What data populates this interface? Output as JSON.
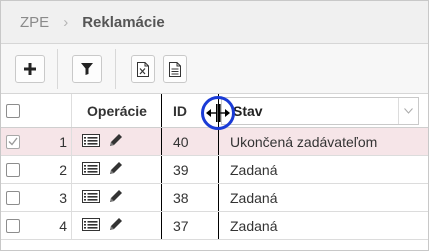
{
  "breadcrumb": {
    "root": "ZPE",
    "separator": "›",
    "current": "Reklamácie"
  },
  "toolbar": {
    "buttons": [
      {
        "name": "add-button",
        "icon": "plus-icon"
      },
      {
        "name": "filter-button",
        "icon": "funnel-icon"
      },
      {
        "name": "export-excel-button",
        "icon": "excel-file-icon"
      },
      {
        "name": "export-document-button",
        "icon": "document-icon"
      }
    ]
  },
  "grid": {
    "columns": {
      "operations": "Operácie",
      "id": "ID",
      "status": "Stav"
    },
    "rows": [
      {
        "index": "1",
        "id": "40",
        "status": "Ukončená zadávateľom",
        "checked": true,
        "selected": true
      },
      {
        "index": "2",
        "id": "39",
        "status": "Zadaná",
        "checked": false,
        "selected": false
      },
      {
        "index": "3",
        "id": "38",
        "status": "Zadaná",
        "checked": false,
        "selected": false
      },
      {
        "index": "4",
        "id": "37",
        "status": "Zadaná",
        "checked": false,
        "selected": false
      }
    ]
  },
  "colors": {
    "selected_row": "#f6e5e8",
    "cursor_ring": "#1a3bd6"
  }
}
